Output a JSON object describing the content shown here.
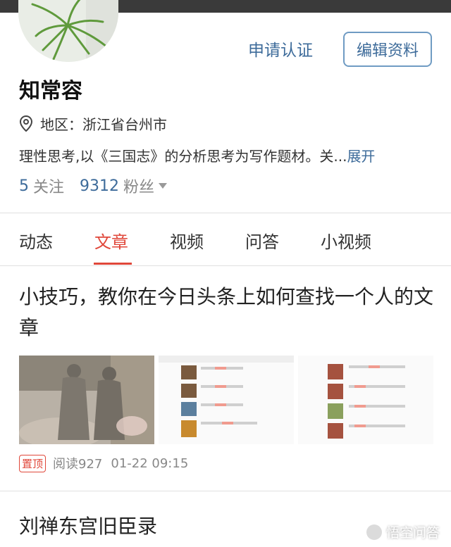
{
  "profile": {
    "name": "知常容",
    "region_label": "地区：浙江省台州市",
    "bio": "理性思考,以《三国志》的分析思考为写作题材。关...",
    "bio_expand": "展开",
    "following_count": "5",
    "following_label": "关注",
    "fans_count": "9312",
    "fans_label": "粉丝"
  },
  "actions": {
    "certify": "申请认证",
    "edit": "编辑资料"
  },
  "tabs": [
    {
      "label": "动态",
      "active": false
    },
    {
      "label": "文章",
      "active": true
    },
    {
      "label": "视频",
      "active": false
    },
    {
      "label": "问答",
      "active": false
    },
    {
      "label": "小视频",
      "active": false
    }
  ],
  "articles": [
    {
      "title": "小技巧，教你在今日头条上如何查找一个人的文章",
      "pin_badge": "置顶",
      "reads": "阅读927",
      "time": "01-22 09:15"
    },
    {
      "title": "刘禅东宫旧臣录"
    }
  ],
  "watermark": "悟空问答",
  "colors": {
    "accent_red": "#e0473a",
    "link_blue": "#3d6b9a"
  }
}
